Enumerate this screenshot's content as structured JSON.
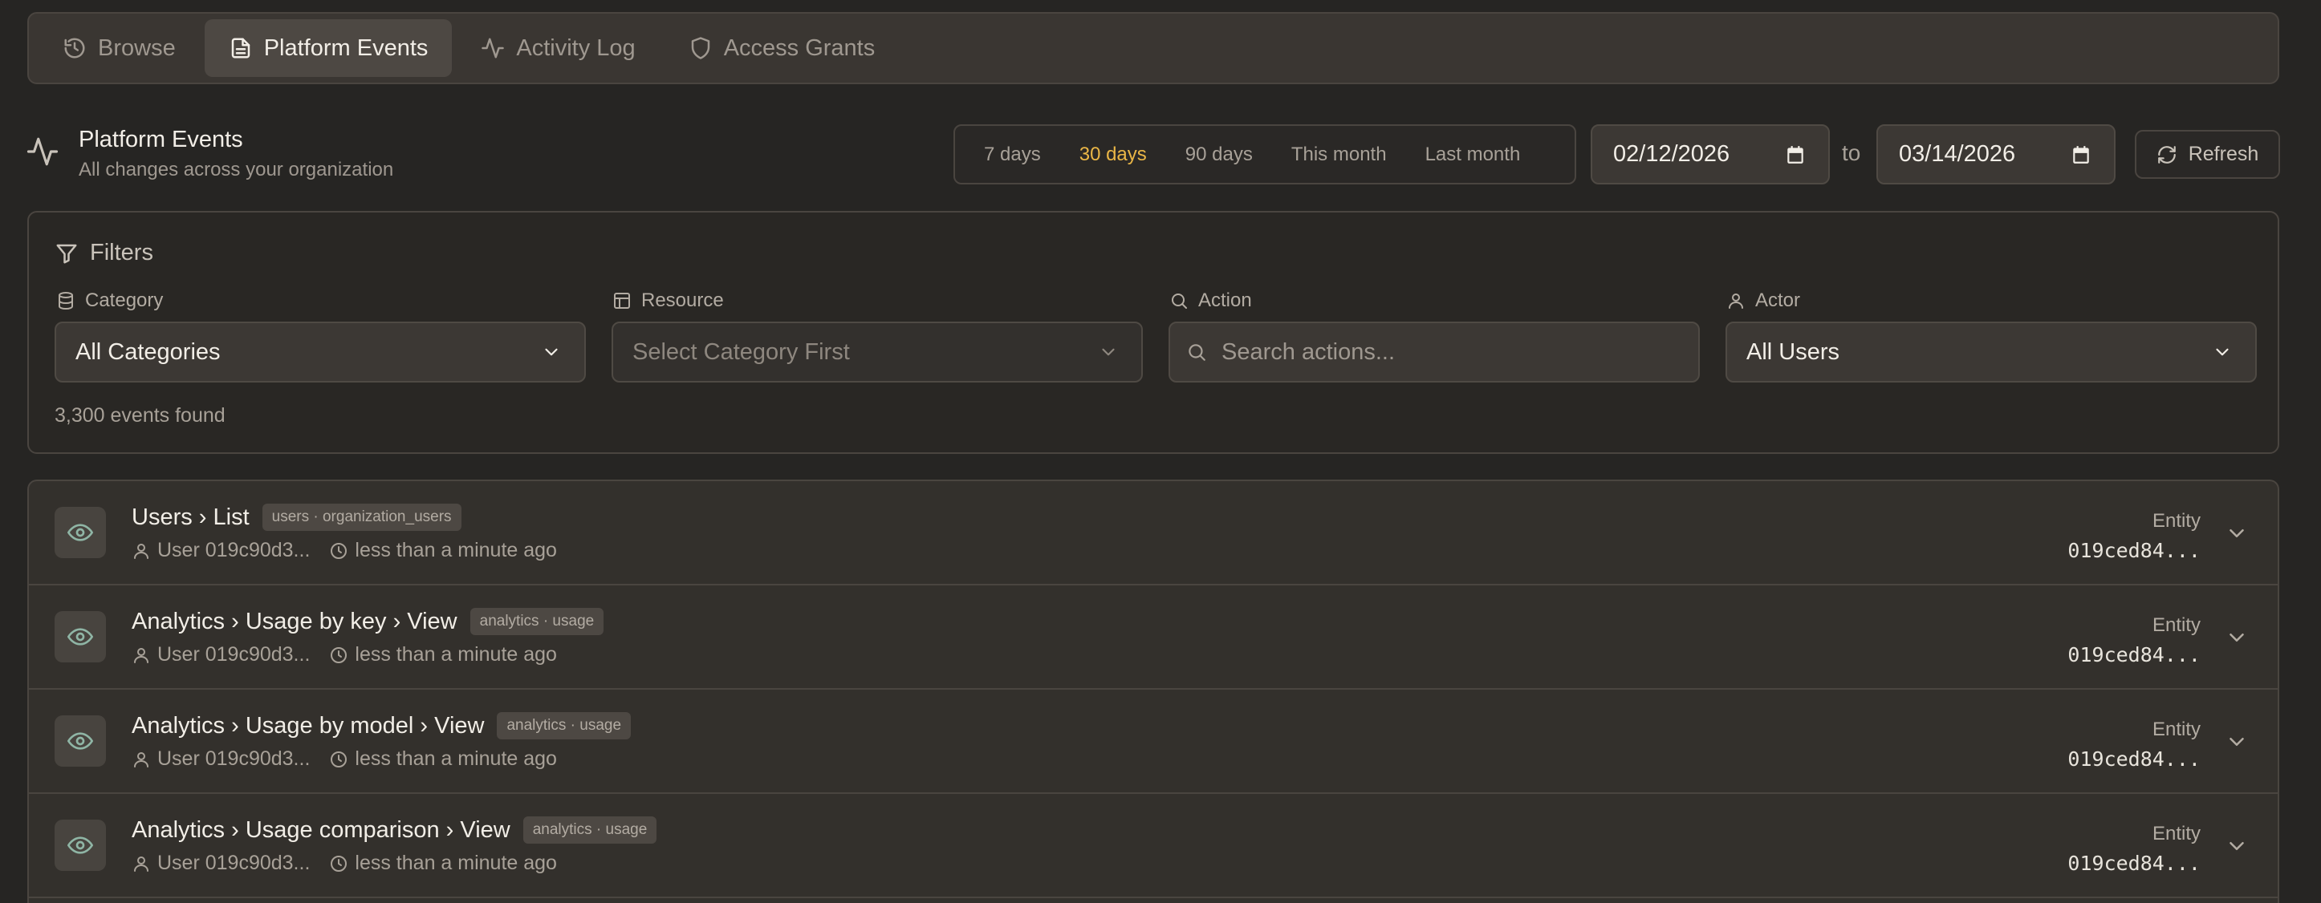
{
  "tabs": [
    {
      "label": "Browse",
      "icon": "history-icon",
      "active": false
    },
    {
      "label": "Platform Events",
      "icon": "document-icon",
      "active": true
    },
    {
      "label": "Activity Log",
      "icon": "activity-icon",
      "active": false
    },
    {
      "label": "Access Grants",
      "icon": "shield-icon",
      "active": false
    }
  ],
  "header": {
    "title": "Platform Events",
    "subtitle": "All changes across your organization"
  },
  "range": {
    "options": [
      "7 days",
      "30 days",
      "90 days",
      "This month",
      "Last month"
    ],
    "active": "30 days",
    "accent_color": "#eab646"
  },
  "dates": {
    "from": "02/12/2026",
    "to_label": "to",
    "to": "03/14/2026"
  },
  "refresh_label": "Refresh",
  "filters": {
    "title": "Filters",
    "category": {
      "label": "Category",
      "value": "All Categories"
    },
    "resource": {
      "label": "Resource",
      "value": "Select Category First"
    },
    "action": {
      "label": "Action",
      "placeholder": "Search actions..."
    },
    "actor": {
      "label": "Actor",
      "value": "All Users"
    },
    "count_text": "3,300 events found"
  },
  "events": [
    {
      "title": "Users › List",
      "badge": "users · organization_users",
      "user": "User 019c90d3...",
      "time": "less than a minute ago",
      "entity_label": "Entity",
      "entity_value": "019ced84..."
    },
    {
      "title": "Analytics › Usage by key › View",
      "badge": "analytics · usage",
      "user": "User 019c90d3...",
      "time": "less than a minute ago",
      "entity_label": "Entity",
      "entity_value": "019ced84..."
    },
    {
      "title": "Analytics › Usage by model › View",
      "badge": "analytics · usage",
      "user": "User 019c90d3...",
      "time": "less than a minute ago",
      "entity_label": "Entity",
      "entity_value": "019ced84..."
    },
    {
      "title": "Analytics › Usage comparison › View",
      "badge": "analytics · usage",
      "user": "User 019c90d3...",
      "time": "less than a minute ago",
      "entity_label": "Entity",
      "entity_value": "019ced84..."
    }
  ]
}
